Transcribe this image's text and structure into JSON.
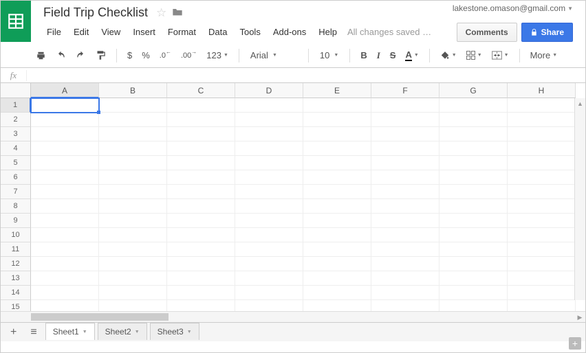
{
  "doc": {
    "title": "Field Trip Checklist"
  },
  "user": {
    "email": "lakestone.omason@gmail.com"
  },
  "menus": [
    "File",
    "Edit",
    "View",
    "Insert",
    "Format",
    "Data",
    "Tools",
    "Add-ons",
    "Help"
  ],
  "save_status": "All changes saved …",
  "buttons": {
    "comments": "Comments",
    "share": "Share"
  },
  "toolbar": {
    "currency": "$",
    "percent": "%",
    "dec_dec": ".0",
    "inc_dec": ".00",
    "more_fmt": "123",
    "font": "Arial",
    "font_size": "10",
    "bold": "B",
    "italic": "I",
    "strike": "S",
    "textcolor": "A",
    "more": "More"
  },
  "columns": [
    "A",
    "B",
    "C",
    "D",
    "E",
    "F",
    "G",
    "H"
  ],
  "rows": [
    "1",
    "2",
    "3",
    "4",
    "5",
    "6",
    "7",
    "8",
    "9",
    "10",
    "11",
    "12",
    "13",
    "14",
    "15"
  ],
  "sheets": [
    "Sheet1",
    "Sheet2",
    "Sheet3"
  ],
  "active_cell": {
    "row": 0,
    "col": 0
  }
}
